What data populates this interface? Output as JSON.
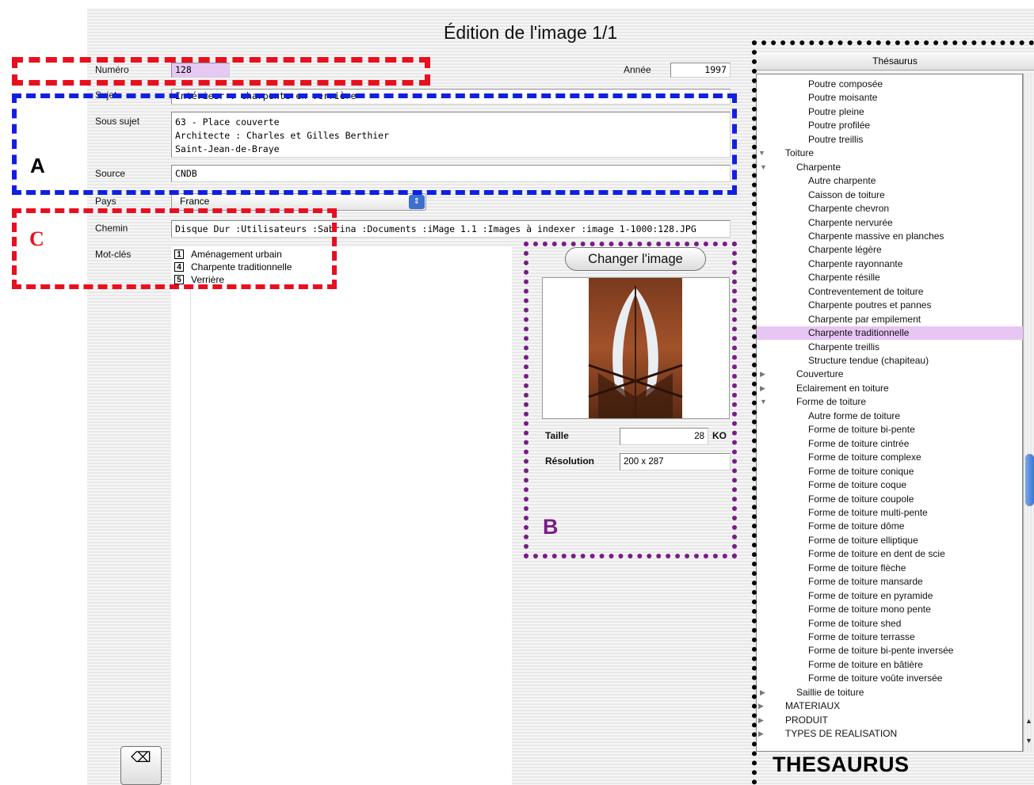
{
  "window": {
    "title": "Édition de l'image 1/1"
  },
  "form": {
    "numero": {
      "label": "Numéro",
      "value": "128"
    },
    "annee": {
      "label": "Année",
      "value": "1997"
    },
    "sujet": {
      "label": "Sujet",
      "value": "Intérieur : charpente en verrière"
    },
    "sous_sujet": {
      "label": "Sous sujet",
      "value": "63 - Place couverte\nArchitecte : Charles et Gilles Berthier\nSaint-Jean-de-Braye"
    },
    "source": {
      "label": "Source",
      "value": "CNDB"
    },
    "pays": {
      "label": "Pays",
      "value": "France"
    },
    "chemin": {
      "label": "Chemin",
      "value": "Disque Dur :Utilisateurs :Sabrina :Documents :iMage 1.1 :Images à indexer :image 1-1000:128.JPG"
    },
    "mot_cles": {
      "label": "Mot-clés",
      "items": [
        {
          "num": "1",
          "text": "Aménagement urbain"
        },
        {
          "num": "4",
          "text": "Charpente traditionnelle"
        },
        {
          "num": "5",
          "text": "Verrière"
        }
      ]
    }
  },
  "image_panel": {
    "change_button": "Changer l'image",
    "taille_label": "Taille",
    "taille_value": "28",
    "taille_unit": "KO",
    "resolution_label": "Résolution",
    "resolution_value": "200 x 287"
  },
  "thesaurus": {
    "header": "Thésaurus",
    "caption": "THESAURUS",
    "items": [
      {
        "text": "Poutre composée",
        "level": 2
      },
      {
        "text": "Poutre moisante",
        "level": 2
      },
      {
        "text": "Poutre pleine",
        "level": 2
      },
      {
        "text": "Poutre profilée",
        "level": 2
      },
      {
        "text": "Poutre treillis",
        "level": 2
      },
      {
        "text": "Toiture",
        "level": 0,
        "tri": "open"
      },
      {
        "text": "Charpente",
        "level": 1,
        "tri": "open"
      },
      {
        "text": "Autre charpente",
        "level": 2
      },
      {
        "text": "Caisson de toiture",
        "level": 2
      },
      {
        "text": "Charpente chevron",
        "level": 2
      },
      {
        "text": "Charpente  nervurée",
        "level": 2
      },
      {
        "text": "Charpente massive en planches",
        "level": 2
      },
      {
        "text": "Charpente légère",
        "level": 2
      },
      {
        "text": "Charpente rayonnante",
        "level": 2
      },
      {
        "text": "Charpente résille",
        "level": 2
      },
      {
        "text": "Contreventement de toiture",
        "level": 2
      },
      {
        "text": "Charpente poutres et pannes",
        "level": 2
      },
      {
        "text": "Charpente par empilement",
        "level": 2
      },
      {
        "text": "Charpente traditionnelle",
        "level": 2,
        "selected": true
      },
      {
        "text": "Charpente treillis",
        "level": 2
      },
      {
        "text": "Structure tendue (chapiteau)",
        "level": 2
      },
      {
        "text": "Couverture",
        "level": 1,
        "tri": "closed"
      },
      {
        "text": "Eclairement en toiture",
        "level": 1,
        "tri": "closed"
      },
      {
        "text": "Forme de toiture",
        "level": 1,
        "tri": "open"
      },
      {
        "text": "Autre forme de toiture",
        "level": 2
      },
      {
        "text": "Forme de toiture bi-pente",
        "level": 2
      },
      {
        "text": "Forme de toiture cintrée",
        "level": 2
      },
      {
        "text": "Forme de toiture complexe",
        "level": 2
      },
      {
        "text": "Forme de toiture conique",
        "level": 2
      },
      {
        "text": "Forme de toiture coque",
        "level": 2
      },
      {
        "text": "Forme de toiture coupole",
        "level": 2
      },
      {
        "text": "Forme de toiture multi-pente",
        "level": 2
      },
      {
        "text": "Forme de toiture dôme",
        "level": 2
      },
      {
        "text": "Forme de toiture elliptique",
        "level": 2
      },
      {
        "text": "Forme de toiture en dent de scie",
        "level": 2
      },
      {
        "text": "Forme de toiture flèche",
        "level": 2
      },
      {
        "text": "Forme de toiture mansarde",
        "level": 2
      },
      {
        "text": "Forme de toiture en pyramide",
        "level": 2
      },
      {
        "text": "Forme de toiture mono pente",
        "level": 2
      },
      {
        "text": "Forme de toiture shed",
        "level": 2
      },
      {
        "text": "Forme de toiture terrasse",
        "level": 2
      },
      {
        "text": "Forme de toiture bi-pente inversée",
        "level": 2
      },
      {
        "text": "Forme de toiture en bâtière",
        "level": 2
      },
      {
        "text": "Forme de toiture voûte inversée",
        "level": 2
      },
      {
        "text": "Saillie de toiture",
        "level": 1,
        "tri": "closed"
      },
      {
        "text": "MATERIAUX",
        "level": 0,
        "tri": "closed"
      },
      {
        "text": "PRODUIT",
        "level": 0,
        "tri": "closed"
      },
      {
        "text": "TYPES DE REALISATION",
        "level": 0,
        "tri": "closed"
      }
    ]
  },
  "annotations": {
    "a": "A",
    "b": "B",
    "c": "C"
  },
  "colors": {
    "annotation_red": "#e8101e",
    "annotation_blue": "#1020e0",
    "annotation_purple": "#7b1a8a",
    "selection": "#e7c6f3"
  }
}
